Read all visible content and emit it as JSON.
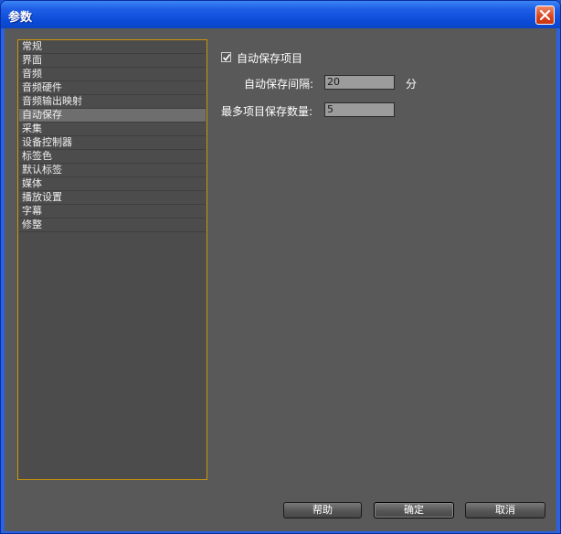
{
  "window": {
    "title": "参数"
  },
  "sidebar": {
    "items": [
      {
        "label": "常规"
      },
      {
        "label": "界面"
      },
      {
        "label": "音频"
      },
      {
        "label": "音频硬件"
      },
      {
        "label": "音频输出映射"
      },
      {
        "label": "自动保存"
      },
      {
        "label": "采集"
      },
      {
        "label": "设备控制器"
      },
      {
        "label": "标签色"
      },
      {
        "label": "默认标签"
      },
      {
        "label": "媒体"
      },
      {
        "label": "播放设置"
      },
      {
        "label": "字幕"
      },
      {
        "label": "修整"
      }
    ],
    "selected_label": "自动保存"
  },
  "autosave": {
    "enable_label": "自动保存项目",
    "enable_checked": true,
    "interval_label": "自动保存间隔:",
    "interval_value": "20",
    "interval_unit": "分",
    "max_label": "最多项目保存数量:",
    "max_value": "5"
  },
  "buttons": {
    "help": "帮助",
    "ok": "确定",
    "cancel": "取消"
  },
  "colors": {
    "titlebar": "#0a4ad6",
    "panel_bg": "#595959",
    "sidebar_border": "#c8960c",
    "selected_bg": "#6e6e6e"
  }
}
